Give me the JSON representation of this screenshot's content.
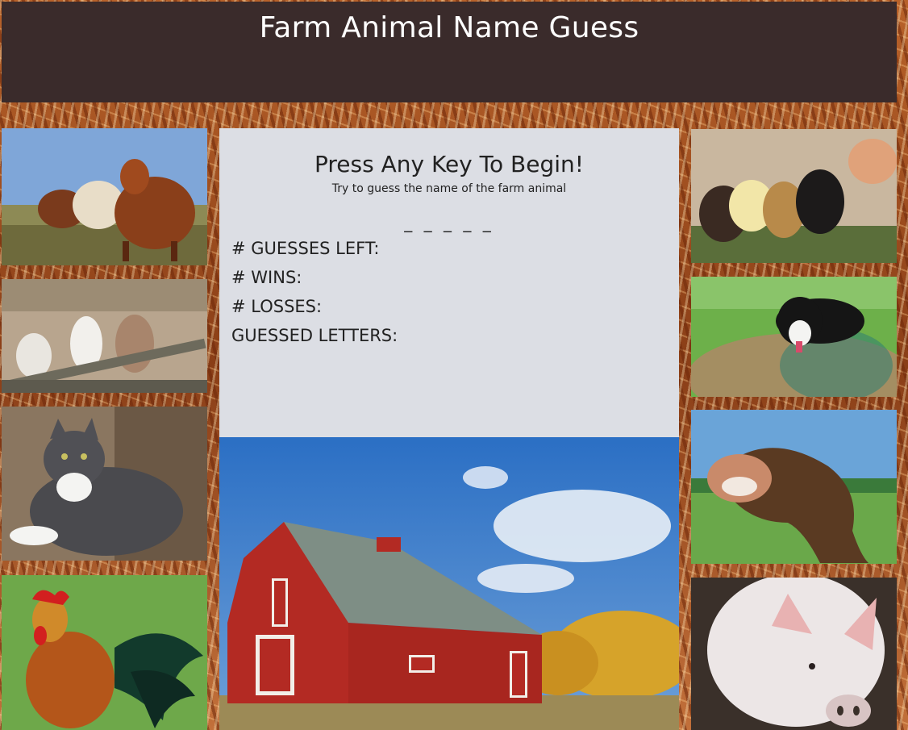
{
  "header": {
    "title": "Farm Animal Name Guess"
  },
  "game": {
    "prompt": "Press Any Key To Begin!",
    "instructions": "Try to guess the name of the farm animal",
    "word_blanks": "_ _ _ _ _",
    "guesses_left_label": "# GUESSES LEFT:",
    "wins_label": "# WINS:",
    "losses_label": "# LOSSES:",
    "guessed_letters_label": "GUESSED LETTERS:"
  },
  "images": {
    "left": [
      "cows-photo",
      "goats-photo",
      "cat-photo",
      "rooster-photo"
    ],
    "right": [
      "chicks-photo",
      "dog-photo",
      "horse-photo",
      "pig-photo"
    ],
    "center": "barn-photo"
  },
  "colors": {
    "header_bg": "#3a2b2b",
    "panel_bg": "#dcdee4",
    "barn_red": "#b32a23",
    "sky_blue": "#2f74c8"
  }
}
